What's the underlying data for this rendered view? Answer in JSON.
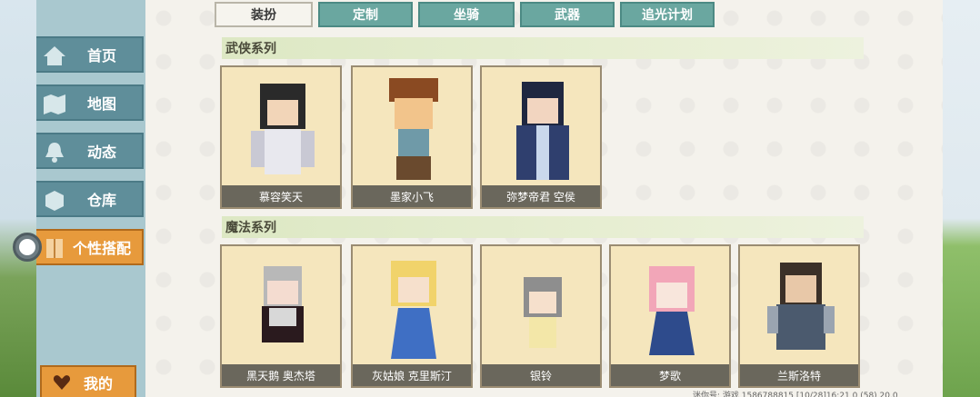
{
  "sidebar": {
    "items": [
      {
        "label": "首页",
        "icon": "home-icon"
      },
      {
        "label": "地图",
        "icon": "map-icon"
      },
      {
        "label": "动态",
        "icon": "bell-icon"
      },
      {
        "label": "仓库",
        "icon": "box-icon"
      },
      {
        "label": "个性搭配",
        "icon": "wardrobe-icon",
        "active": true
      }
    ],
    "mine_label": "我的"
  },
  "tabs": [
    "装扮",
    "定制",
    "坐骑",
    "武器",
    "追光计划"
  ],
  "sections": [
    {
      "title": "武侠系列",
      "items": [
        "慕容笑天",
        "墨家小飞",
        "弥梦帝君 空侯"
      ]
    },
    {
      "title": "魔法系列",
      "items": [
        "黑天鹅 奥杰塔",
        "灰姑娘 克里斯汀",
        "银铃",
        "梦歌",
        "兰斯洛特"
      ]
    }
  ],
  "footer": {
    "text": "迷你号: 游戏 1586788815 [10/28]16:21 0 (58) 20.0"
  }
}
